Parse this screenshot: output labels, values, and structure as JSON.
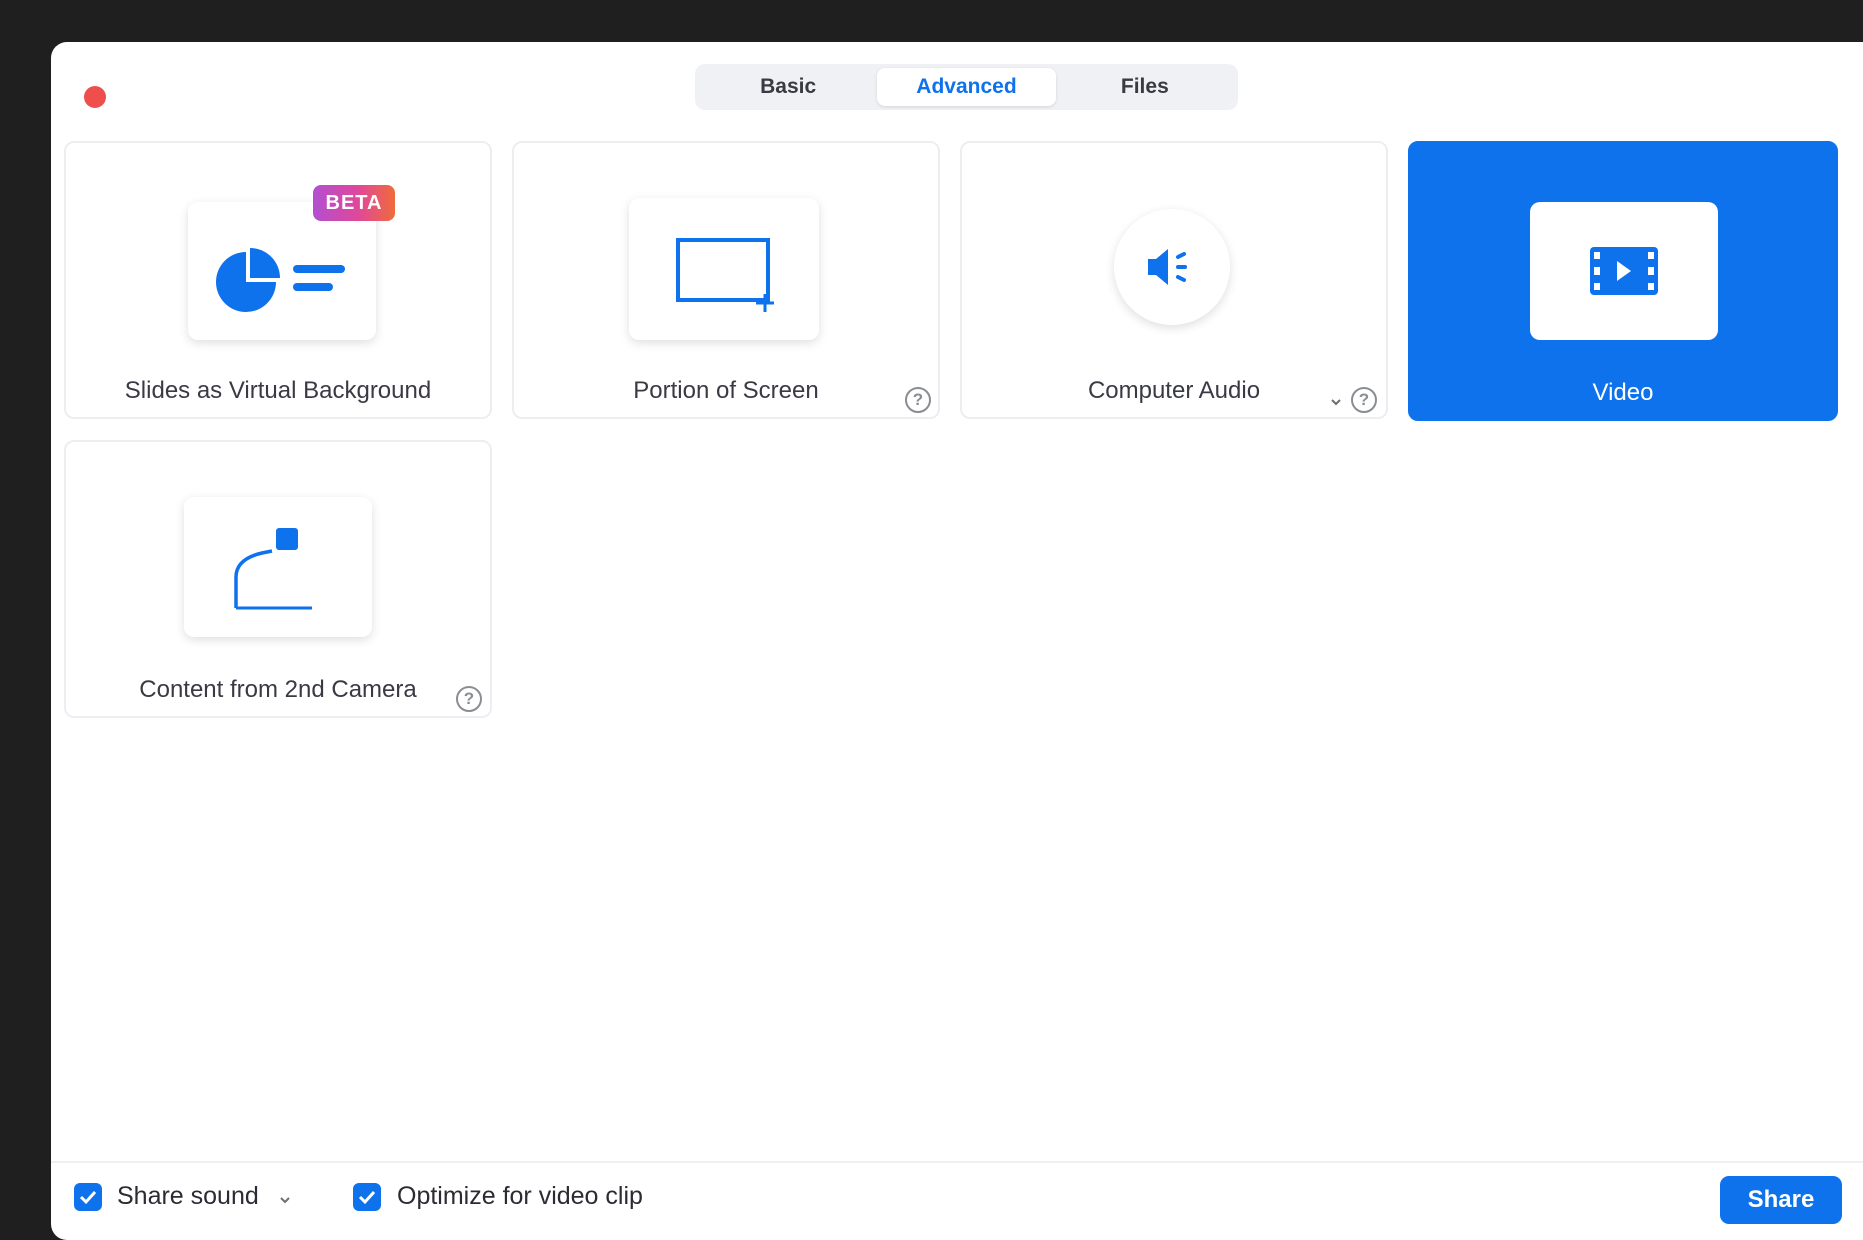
{
  "tabs": [
    {
      "label": "Basic",
      "active": false
    },
    {
      "label": "Advanced",
      "active": true
    },
    {
      "label": "Files",
      "active": false
    }
  ],
  "cards": {
    "slides": {
      "label": "Slides as Virtual Background",
      "badge": "BETA"
    },
    "portion": {
      "label": "Portion of Screen"
    },
    "audio": {
      "label": "Computer Audio"
    },
    "video": {
      "label": "Video",
      "selected": true
    },
    "camera": {
      "label": "Content from 2nd Camera"
    }
  },
  "footer": {
    "share_sound": {
      "label": "Share sound",
      "checked": true
    },
    "optimize_video": {
      "label": "Optimize for video clip",
      "checked": true
    },
    "share_button": "Share"
  },
  "colors": {
    "accent": "#0e72ed",
    "close": "#ee4f4c",
    "badge_gradient": [
      "#b34ed1",
      "#f06a3a"
    ]
  },
  "icons": [
    "pie-chart-icon",
    "text-lines-icon",
    "screen-portion-icon",
    "speaker-icon",
    "film-icon",
    "document-camera-icon",
    "help-icon",
    "chevron-down-icon",
    "check-icon"
  ]
}
